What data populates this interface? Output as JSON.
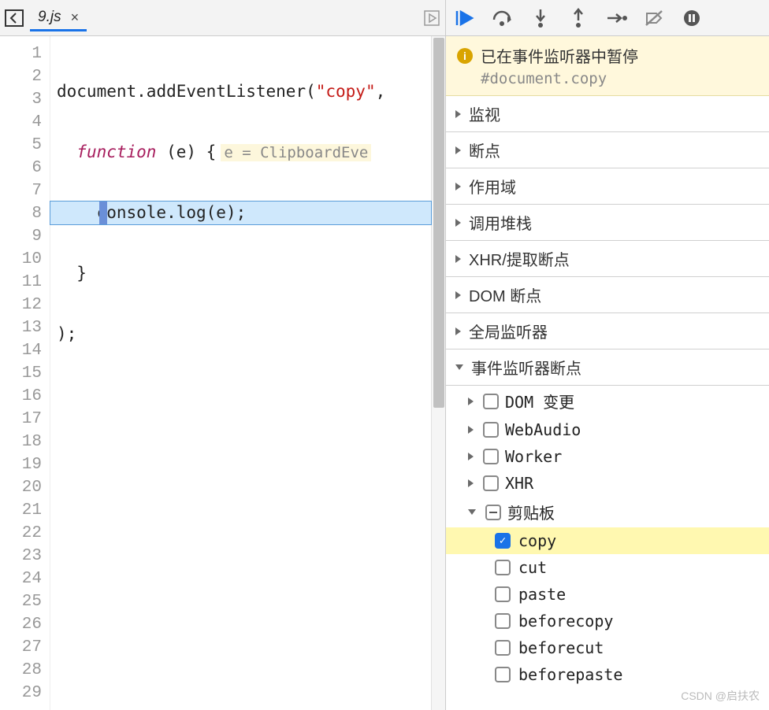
{
  "tab": {
    "filename": "9.js"
  },
  "code": {
    "lines": [
      1,
      2,
      3,
      4,
      5,
      6,
      7,
      8,
      9,
      10,
      11,
      12,
      13,
      14,
      15,
      16,
      17,
      18,
      19,
      20,
      21,
      22,
      23,
      24,
      25,
      26,
      27,
      28,
      29
    ],
    "activeLine": 3,
    "l1_a": "document",
    "l1_b": ".addEventListener(",
    "l1_str": "\"copy\"",
    "l1_c": ",",
    "l2_kw": "function",
    "l2_rest": " (e) {",
    "l2_hint": "e = ClipboardEve",
    "l3": "console.log(e);",
    "l4": "}",
    "l5": ");"
  },
  "paused": {
    "message": "已在事件监听器中暂停",
    "detail": "#document.copy"
  },
  "panels": {
    "watch": "监视",
    "breakpoints": "断点",
    "scope": "作用域",
    "callstack": "调用堆栈",
    "xhr": "XHR/提取断点",
    "dom": "DOM 断点",
    "global": "全局监听器",
    "event": "事件监听器断点"
  },
  "eventCats": {
    "dom": "DOM 变更",
    "webaudio": "WebAudio",
    "worker": "Worker",
    "xhr": "XHR",
    "clipboard": "剪贴板"
  },
  "clipboardEvents": {
    "copy": "copy",
    "cut": "cut",
    "paste": "paste",
    "beforecopy": "beforecopy",
    "beforecut": "beforecut",
    "beforepaste": "beforepaste"
  },
  "watermark": "CSDN @启扶农"
}
